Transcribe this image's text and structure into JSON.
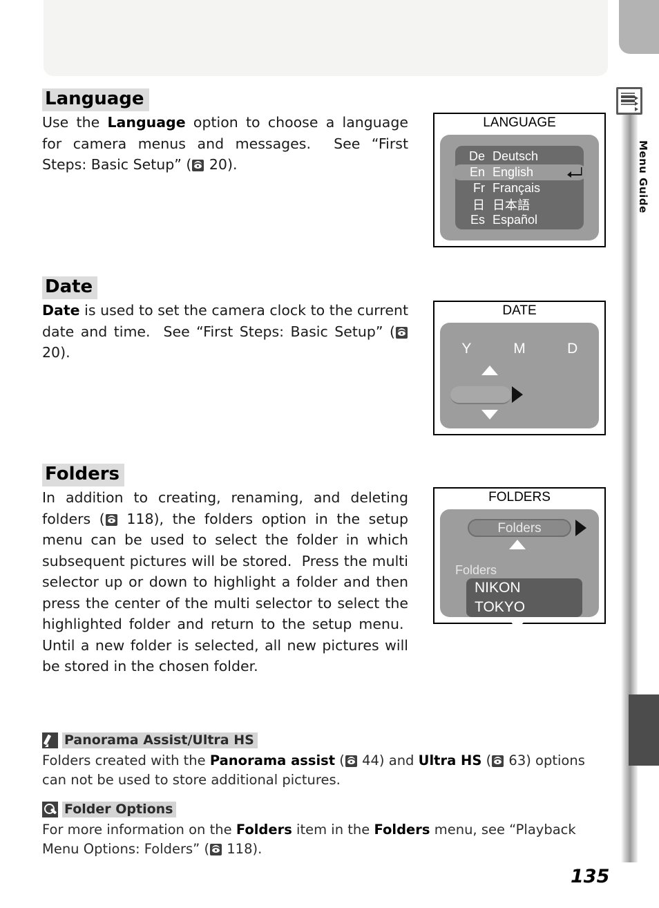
{
  "page": {
    "number": "135",
    "rail_label": "Menu Guide",
    "rail_icon": "menu-list-icon"
  },
  "sections": [
    {
      "heading": "Language",
      "body_html": "Use the <b>Language</b> option to choose a language for camera menus and messages.&nbsp; See “First Steps: Basic Setup” (<span class=\"reficon\"><i></i></span> 20)."
    },
    {
      "heading": "Date",
      "body_html": "<b>Date</b> is used to set the camera clock to the current date and time.&nbsp; See “First Steps: Basic Setup” (<span class=\"reficon\"><i></i></span> 20)."
    },
    {
      "heading": "Folders",
      "body_html": "In addition to creating, renaming, and deleting folders (<span class=\"reficon\"><i></i></span> 118), the folders option in the setup menu can be used to select the folder in which subsequent pictures will be stored.&nbsp; Press the multi selector up or down to highlight a folder and then press the center of the multi selector to select the highlighted folder and return to the setup menu.&nbsp; Until a new folder is selected, all new pictures will be stored in the chosen folder."
    }
  ],
  "screens": {
    "language": {
      "title": "LANGUAGE",
      "items": [
        {
          "code": "De",
          "name": "Deutsch",
          "selected": false
        },
        {
          "code": "En",
          "name": "English",
          "selected": true
        },
        {
          "code": "Fr",
          "name": "Français",
          "selected": false
        },
        {
          "code": "日",
          "name": "日本語",
          "selected": false
        },
        {
          "code": "Es",
          "name": "Español",
          "selected": false
        }
      ],
      "enter_icon": "enter-return-icon"
    },
    "date": {
      "title": "DATE",
      "columns": [
        "Y",
        "M",
        "D"
      ],
      "up_icon": "triangle-up-icon",
      "down_icon": "triangle-down-icon",
      "right_icon": "triangle-right-icon",
      "value_field": ""
    },
    "folders": {
      "title": "FOLDERS",
      "pill_label": "Folders",
      "list_label": "Folders",
      "items": [
        "NIKON",
        "TOKYO"
      ],
      "up_icon": "triangle-up-icon",
      "down_icon": "triangle-down-icon",
      "right_icon": "triangle-right-icon"
    }
  },
  "notes": [
    {
      "icon": "pencil-icon",
      "title": "Panorama Assist/Ultra HS",
      "body_html": "Folders created with the <b>Panorama assist</b> (<span class=\"reficon\"><i></i></span> 44) and <b>Ultra HS</b> (<span class=\"reficon\"><i></i></span> 63) options can not be used to store additional pictures."
    },
    {
      "icon": "magnifier-icon",
      "title": "Folder Options",
      "body_html": "For more information on the <b>Folders</b> item in the <b>Folders</b> menu, see “Playback Menu Options: Folders” (<span class=\"reficon\"><i></i></span> 118)."
    }
  ],
  "colors": {
    "lcd_background": "#9d9d9d",
    "lcd_list": "#6b6b6b",
    "heading_highlight": "#dcdcdc",
    "note_highlight": "#d4d4d4",
    "rail_dark_tab": "#4c4c4c"
  }
}
